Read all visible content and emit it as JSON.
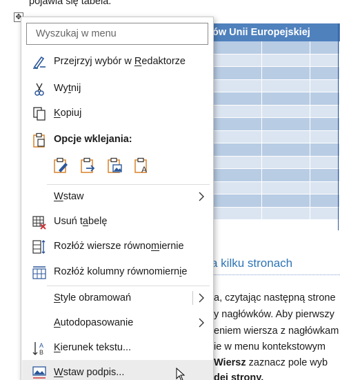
{
  "document": {
    "top_line": "pojawia się tabela.",
    "table_header": "ów Unii Europejskiej",
    "heading": "a  kilku stronach",
    "paragraph_lines": [
      "a, czytając następną strone",
      "y nagłówków. Aby pierwszy",
      "eniem wiersza z nagłówkam",
      "ie w menu kontekstowym",
      "Wiersz zaznacz pole wyb",
      "dej strony."
    ],
    "paragraph_bold_word": "Wiersz"
  },
  "menu": {
    "search_placeholder": "Wyszukaj w menu",
    "items": {
      "review": {
        "pre": "Przejrzyj wybór w ",
        "u": "R",
        "post": "edaktorze"
      },
      "cut": {
        "pre": "Wy",
        "u": "t",
        "post": "nij"
      },
      "copy": {
        "pre": "",
        "u": "K",
        "post": "opiuj"
      },
      "paste_options": {
        "label": "Opcje wklejania:"
      },
      "insert": {
        "pre": "",
        "u": "W",
        "post": "staw"
      },
      "delete_table": {
        "pre": "Usuń t",
        "u": "a",
        "post": "belę"
      },
      "distribute_rows": {
        "pre": "Rozłóż wiersze równo",
        "u": "m",
        "post": "iernie"
      },
      "distribute_cols": {
        "pre": "Rozłóż kolumny równomiern",
        "u": "i",
        "post": "e"
      },
      "border_styles": {
        "pre": "",
        "u": "S",
        "post": "tyle obramowań"
      },
      "autofit": {
        "pre": "",
        "u": "A",
        "post": "utodopasowanie"
      },
      "text_direction": {
        "pre": "",
        "u": "K",
        "post": "ierunek tekstu..."
      },
      "insert_caption": {
        "pre": "",
        "u": "W",
        "post": "staw podpis..."
      }
    }
  },
  "colors": {
    "accent_blue": "#2b579a",
    "paste_orange": "#d9822b",
    "delete_red": "#d13438",
    "table_header": "#4f81bd"
  }
}
